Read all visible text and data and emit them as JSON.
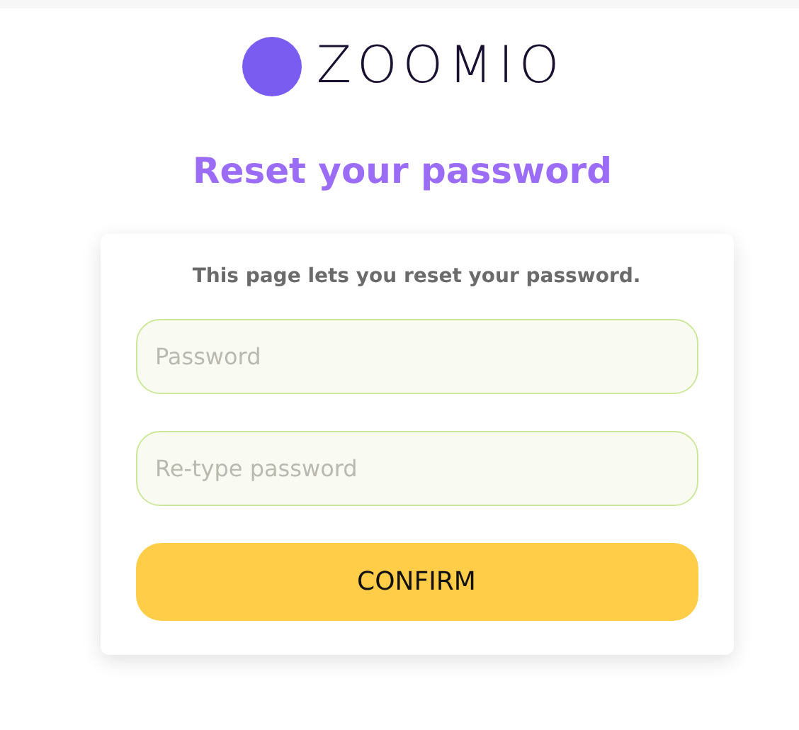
{
  "logo": {
    "text": "ZOOMIO"
  },
  "title": "Reset your password",
  "form": {
    "description": "This page lets you reset your password.",
    "fields": [
      {
        "placeholder": "Password"
      },
      {
        "placeholder": "Re-type password"
      }
    ],
    "button": "CONFIRM"
  }
}
